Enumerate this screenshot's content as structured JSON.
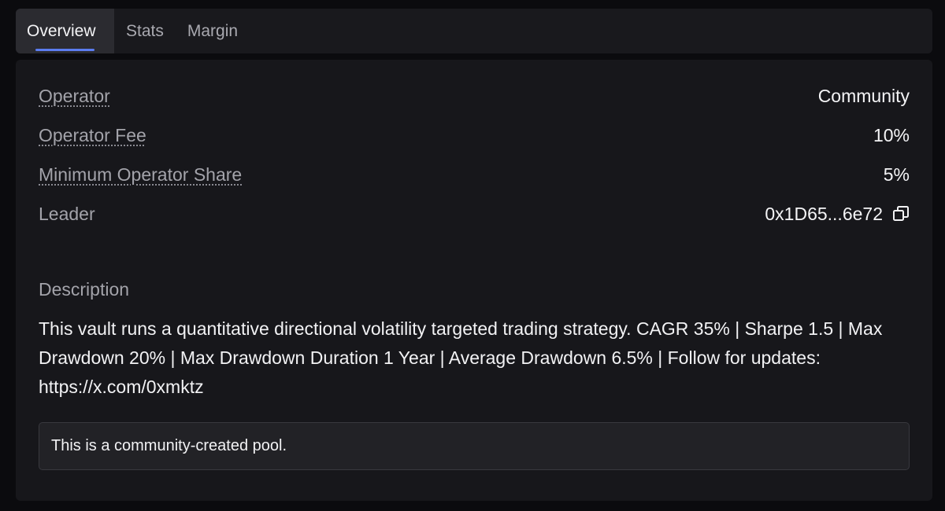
{
  "tabs": [
    {
      "label": "Overview",
      "active": true
    },
    {
      "label": "Stats",
      "active": false
    },
    {
      "label": "Margin",
      "active": false
    }
  ],
  "details": {
    "operator": {
      "label": "Operator",
      "value": "Community"
    },
    "operator_fee": {
      "label": "Operator Fee",
      "value": "10%"
    },
    "min_operator_share": {
      "label": "Minimum Operator Share",
      "value": "5%"
    },
    "leader": {
      "label": "Leader",
      "value": "0x1D65...6e72",
      "icon": "copy-icon"
    }
  },
  "description": {
    "heading": "Description",
    "text": "This vault runs a quantitative directional volatility targeted trading strategy. CAGR 35% | Sharpe 1.5 | Max Drawdown 20% | Max Drawdown Duration 1 Year | Average Drawdown 6.5% | Follow for updates: https://x.com/0xmktz"
  },
  "notice": "This is a community-created pool.",
  "colors": {
    "background": "#0b0b0e",
    "panel": "#17171b",
    "accent": "#5b7cf0",
    "muted_text": "#a3a3aa"
  }
}
